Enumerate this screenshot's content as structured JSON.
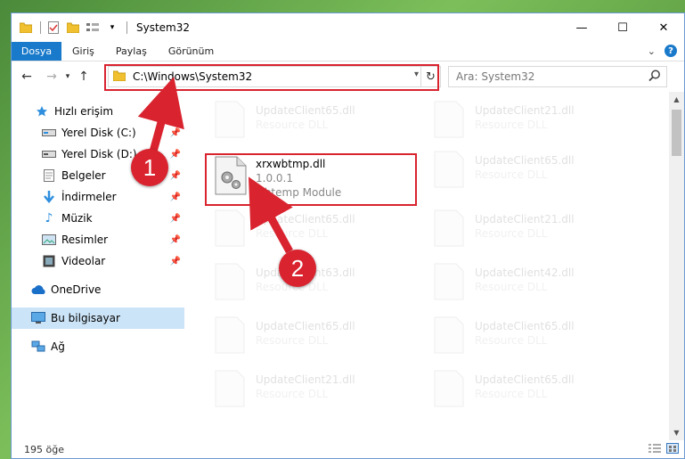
{
  "window": {
    "title": "System32"
  },
  "ribbon": {
    "tabs": [
      "Dosya",
      "Giriş",
      "Paylaş",
      "Görünüm"
    ]
  },
  "address": {
    "path": "C:\\Windows\\System32"
  },
  "search": {
    "placeholder": "Ara: System32"
  },
  "sidebar": {
    "items": [
      {
        "label": "Hızlı erişim",
        "icon": "star-icon",
        "pinned": false
      },
      {
        "label": "Yerel Disk (C:)",
        "icon": "drive-icon",
        "pinned": true
      },
      {
        "label": "Yerel Disk (D:)",
        "icon": "drive-icon",
        "pinned": true
      },
      {
        "label": "Belgeler",
        "icon": "documents-icon",
        "pinned": true
      },
      {
        "label": "İndirmeler",
        "icon": "download-icon",
        "pinned": true
      },
      {
        "label": "Müzik",
        "icon": "music-icon",
        "pinned": true
      },
      {
        "label": "Resimler",
        "icon": "pictures-icon",
        "pinned": true
      },
      {
        "label": "Videolar",
        "icon": "video-icon",
        "pinned": true
      },
      {
        "label": "OneDrive",
        "icon": "cloud-icon",
        "pinned": false
      },
      {
        "label": "Bu bilgisayar",
        "icon": "computer-icon",
        "pinned": false
      },
      {
        "label": "Ağ",
        "icon": "network-icon",
        "pinned": false
      }
    ]
  },
  "files": {
    "highlighted": {
      "name": "xrxwbtmp.dll",
      "version": "1.0.0.1",
      "description": "wbtemp Module"
    },
    "background": [
      {
        "name": "UpdateClient65.dll",
        "type": "Resource DLL"
      },
      {
        "name": "UpdateClient21.dll",
        "type": "Resource DLL"
      },
      {
        "name": "UpdateClient65.dll",
        "type": "Resource DLL"
      },
      {
        "name": "UpdateClient65.dll",
        "type": "Resource DLL"
      },
      {
        "name": "UpdateClient21.dll",
        "type": "Resource DLL"
      },
      {
        "name": "UpdateClient63.dll",
        "type": "Resource DLL"
      },
      {
        "name": "UpdateClient42.dll",
        "type": "Resource DLL"
      },
      {
        "name": "UpdateClient65.dll",
        "type": "Resource DLL"
      },
      {
        "name": "UpdateClient65.dll",
        "type": "Resource DLL"
      },
      {
        "name": "UpdateClient21.dll",
        "type": "Resource DLL"
      },
      {
        "name": "UpdateClient65.dll",
        "type": "Resource DLL"
      }
    ]
  },
  "status": {
    "count": "195 öğe"
  },
  "annotations": {
    "step1": "1",
    "step2": "2"
  },
  "colors": {
    "accent": "#1979ca",
    "highlight": "#d9232f",
    "selection": "#cce4f7"
  }
}
